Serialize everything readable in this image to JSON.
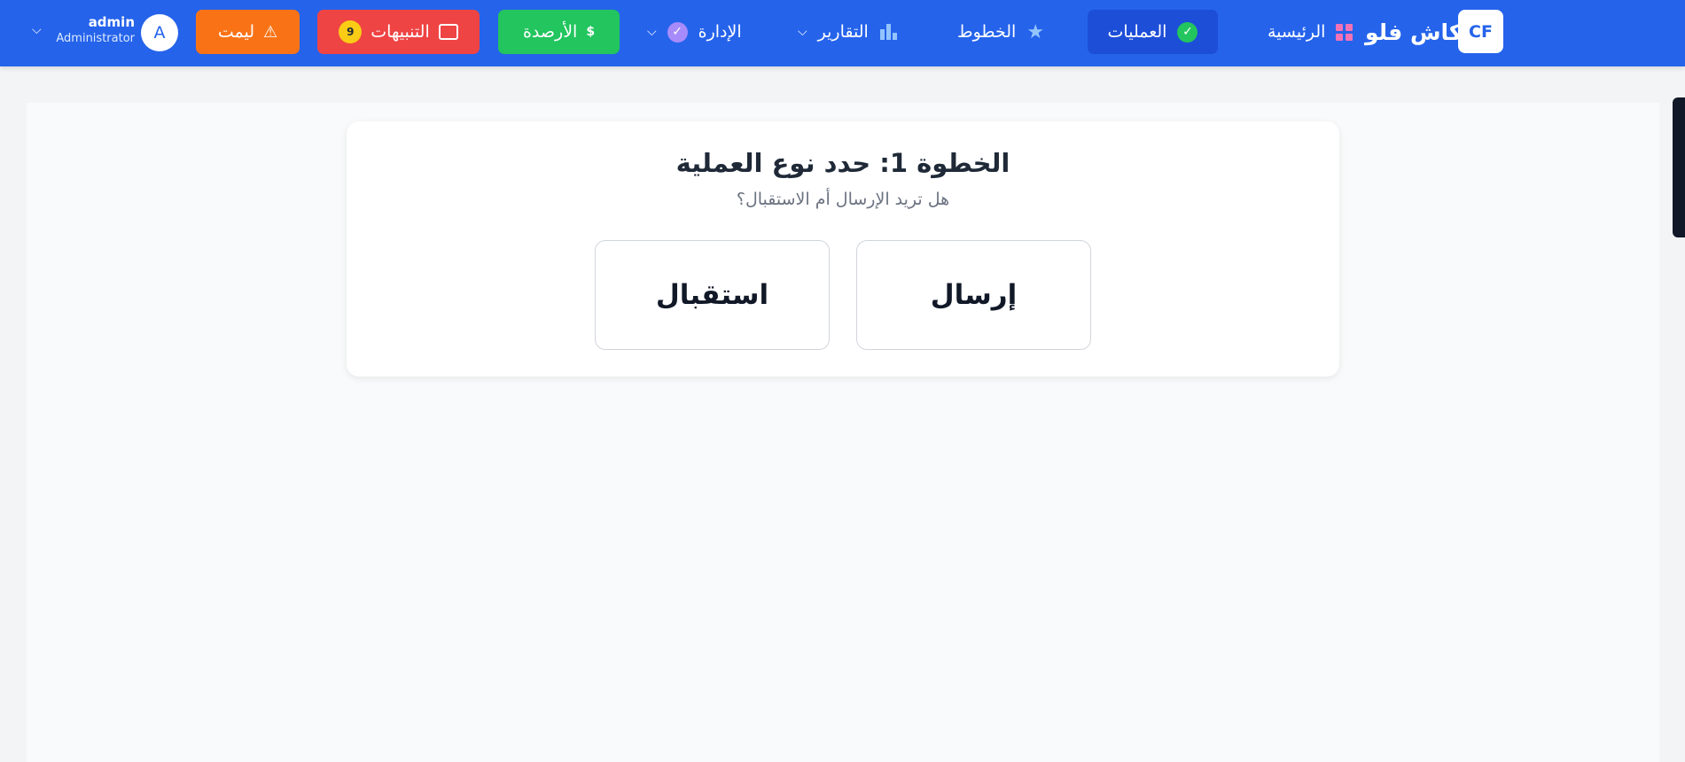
{
  "header": {
    "logo_text": "CF",
    "brand": "كاش فلو",
    "nav": {
      "home": "الرئيسية",
      "operations": "العمليات",
      "lines": "الخطوط",
      "reports": "التقارير",
      "admin": "الإدارة"
    },
    "buttons": {
      "balances": "الأرصدة",
      "alerts": "التنبيهات",
      "alerts_count": "9",
      "limit": "ليمت"
    },
    "user": {
      "avatar_letter": "A",
      "name": "admin",
      "role": "Administrator"
    },
    "icons": [
      "grid-icon",
      "check-circle-icon",
      "star-icon",
      "bar-chart-icon",
      "chevron-down-icon",
      "dollar-icon",
      "chat-icon",
      "warning-icon"
    ]
  },
  "step": {
    "title": "الخطوة 1: حدد نوع العملية",
    "subtitle": "هل تريد الإرسال أم الاستقبال؟",
    "options": {
      "send": "إرسال",
      "receive": "استقبال"
    }
  },
  "colors": {
    "primary": "#2563eb",
    "active_nav": "#1d4ed8",
    "balances": "#22c55e",
    "alerts": "#ef4444",
    "limit": "#f97316",
    "badge": "#facc15"
  }
}
